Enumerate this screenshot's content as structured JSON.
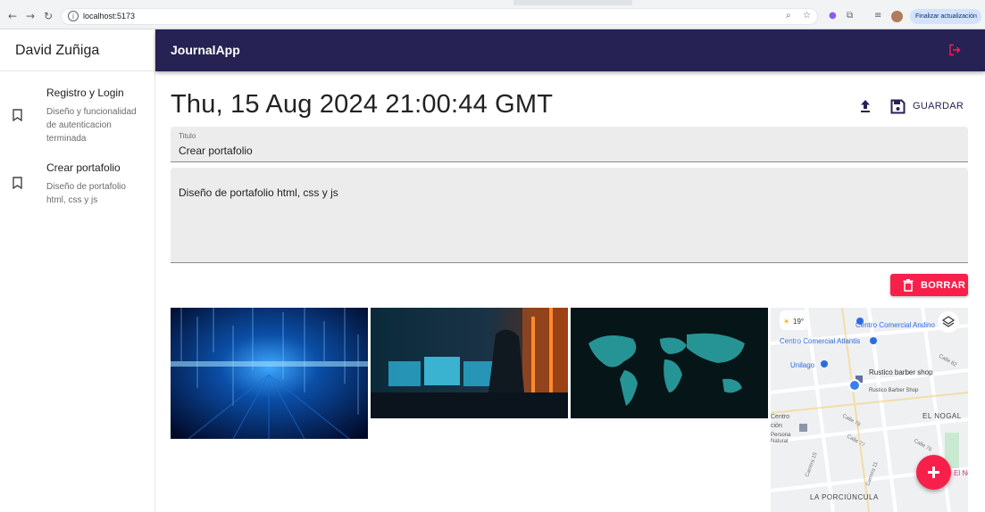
{
  "browser": {
    "url": "localhost:5173",
    "update_label": "Finalizar actualización"
  },
  "sidebar": {
    "user_name": "David Zuñiga",
    "notes": [
      {
        "title": "Registro y Login",
        "body": "Diseño y funcionalidad de autenticacion terminada"
      },
      {
        "title": "Crear portafolio",
        "body": "Diseño de portafolio html, css y js"
      }
    ]
  },
  "appbar": {
    "title": "JournalApp"
  },
  "note": {
    "date": "Thu, 15 Aug 2024 21:00:44 GMT",
    "save_label": "GUARDAR",
    "title_label": "Titulo",
    "title_value": "Crear portafolio",
    "body_value": "Diseño de portafolio html, css y js",
    "delete_label": "BORRAR"
  },
  "map": {
    "weather": "19°",
    "labels": [
      "Centro Comercial Andino",
      "Centro Comercial Atlantis",
      "Unilago",
      "Rustico barber shop",
      "Rustico Barber Shop",
      "EL NOGAL",
      "LA PORCIÚNCULA",
      "Centro",
      "ción",
      "Persona",
      "Natural",
      "Carrera 15",
      "Carrera 11",
      "Calle 82",
      "Calle 79",
      "Calle 77",
      "Calle 76",
      "El No"
    ]
  },
  "colors": {
    "primary": "#262254",
    "accent": "#f6204a"
  }
}
